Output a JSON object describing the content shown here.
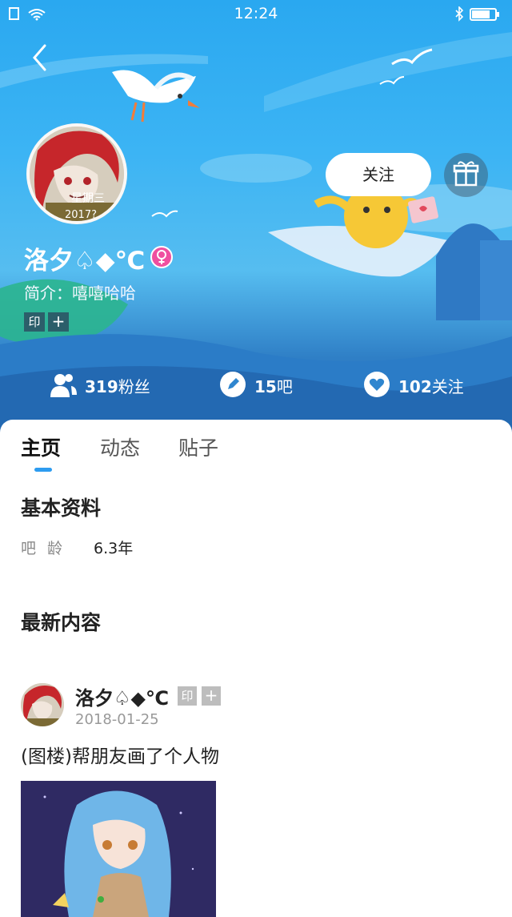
{
  "status_bar": {
    "time": "12:24"
  },
  "profile": {
    "username": "洛夕♤◆℃",
    "bio": "简介：嘻嘻哈哈",
    "tags": [
      "印",
      "+"
    ],
    "follow_label": "关注",
    "avatar_text": "星期三",
    "avatar_year": "2017?"
  },
  "stats": [
    {
      "num": "319",
      "label": "粉丝"
    },
    {
      "num": "15",
      "label": "吧"
    },
    {
      "num": "102",
      "label": "关注"
    }
  ],
  "tabs": [
    "主页",
    "动态",
    "贴子"
  ],
  "basic_info": {
    "title": "基本资料",
    "age_label": "吧龄",
    "age_value": "6.3年"
  },
  "latest": {
    "title": "最新内容",
    "post": {
      "author": "洛夕♤◆℃",
      "tags": [
        "印",
        "+"
      ],
      "date": "2018-01-25",
      "title": "(图楼)帮朋友画了个人物"
    }
  },
  "colors": {
    "accent": "#2d9cf0",
    "gender_female": "#ef4fa0"
  }
}
